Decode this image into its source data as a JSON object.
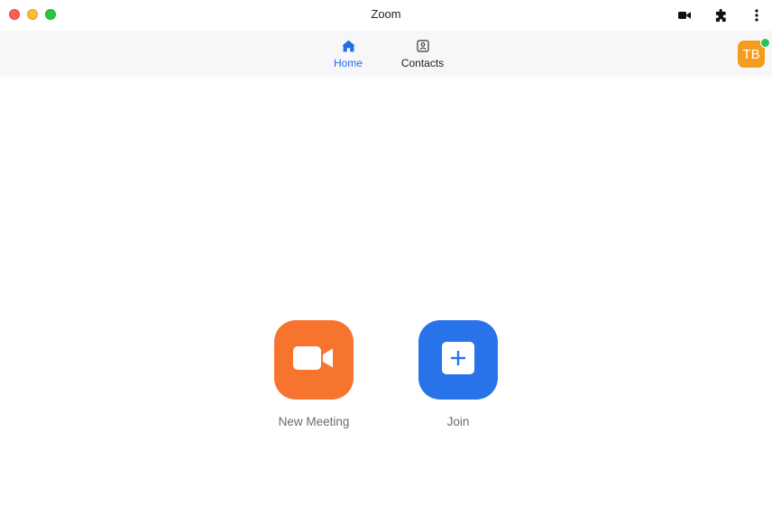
{
  "window": {
    "title": "Zoom"
  },
  "titlebar": {
    "controls": [
      "close",
      "minimize",
      "maximize"
    ],
    "icons": [
      "video-camera-icon",
      "puzzle-icon",
      "more-vertical-icon"
    ]
  },
  "nav": {
    "tabs": [
      {
        "label": "Home",
        "icon": "home-icon",
        "active": true
      },
      {
        "label": "Contacts",
        "icon": "contacts-icon",
        "active": false
      }
    ]
  },
  "profile": {
    "initials": "TB",
    "status": "online",
    "avatar_color": "#f49c1b",
    "status_color": "#23c552"
  },
  "actions": {
    "new_meeting": {
      "label": "New Meeting",
      "icon": "video-camera-icon",
      "color": "#f7742e"
    },
    "join": {
      "label": "Join",
      "icon": "plus-icon",
      "color": "#2873e9"
    }
  },
  "colors": {
    "accent": "#1e6fe8",
    "navbar_bg": "#f7f7f9"
  }
}
